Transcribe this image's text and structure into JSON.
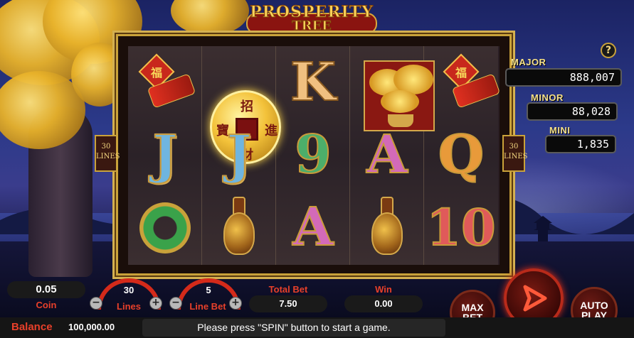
{
  "game": {
    "title_line1": "PROSPERITY",
    "title_line2": "TREE",
    "help_label": "?"
  },
  "reels": {
    "lines_tag_top": "30",
    "lines_tag_bottom": "LINES",
    "coin_chars": [
      "招",
      "進",
      "寶",
      "財"
    ],
    "fu_char": "福",
    "columns": [
      [
        "coin-symbol",
        "J",
        "jade-ring-symbol"
      ],
      [
        "coin-symbol",
        "J",
        "vase-symbol"
      ],
      [
        "K",
        "9",
        "A"
      ],
      [
        "bonsai-symbol",
        "A",
        "vase-symbol"
      ],
      [
        "firecracker-symbol",
        "Q",
        "10"
      ]
    ],
    "symbol_text": {
      "col1_mid": "J",
      "col2_mid": "J",
      "col3_top": "K",
      "col3_mid": "9",
      "col3_bot": "A",
      "col4_mid": "A",
      "col5_mid": "Q",
      "col5_bot": "10"
    }
  },
  "jackpots": {
    "major_label": "MAJOR",
    "major_value": "888,007",
    "minor_label": "MINOR",
    "minor_value": "88,028",
    "mini_label": "MINI",
    "mini_value": "1,835"
  },
  "controls": {
    "coin_value": "0.05",
    "coin_label": "Coin",
    "lines_value": "30",
    "lines_label": "Lines",
    "line_bet_value": "5",
    "line_bet_label": "Line Bet",
    "minus": "−",
    "plus": "+",
    "total_bet_label": "Total Bet",
    "total_bet_value": "7.50",
    "win_label": "Win",
    "win_value": "0.00",
    "max_bet_line1": "MAX",
    "max_bet_line2": "BET",
    "auto_play_line1": "AUTO",
    "auto_play_line2": "PLAY"
  },
  "footer": {
    "balance_label": "Balance",
    "balance_value": "100,000.00",
    "status_message": "Please press \"SPIN\" button to start a game."
  },
  "colors": {
    "accent_red": "#e8402a",
    "gold": "#c9a23a",
    "jackpot_label": "#f5e08a"
  }
}
